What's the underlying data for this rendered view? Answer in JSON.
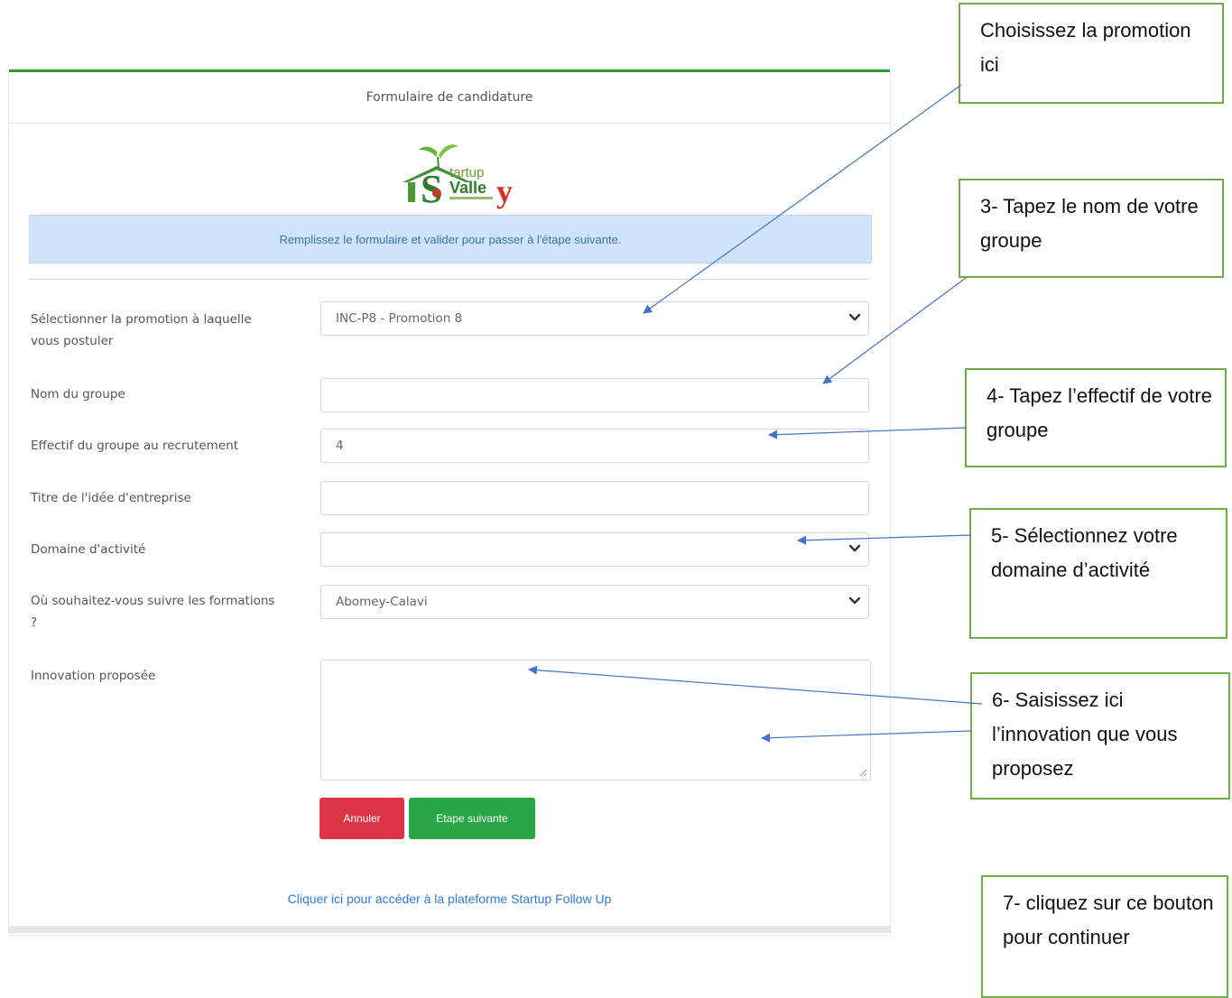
{
  "form": {
    "title": "Formulaire de candidature",
    "banner": "Remplissez le formulaire et valider pour passer à l'étape suivante.",
    "fields": [
      {
        "label": "Sélectionner la promotion à laquelle vous postuler",
        "value": "INC-P8 - Promotion 8",
        "type": "select"
      },
      {
        "label": "Nom du groupe",
        "value": "",
        "type": "text"
      },
      {
        "label": "Effectif du groupe au recrutement",
        "value": "4",
        "type": "number"
      },
      {
        "label": "Titre de l'idée d'entreprise",
        "value": "",
        "type": "text"
      },
      {
        "label": "Domaine d'activité",
        "value": "",
        "type": "select"
      },
      {
        "label": "Où souhaitez-vous suivre les formations ?",
        "value": "Abomey-Calavi",
        "type": "select"
      },
      {
        "label": "Innovation proposée",
        "value": "",
        "type": "textarea"
      }
    ],
    "buttons": {
      "cancel": "Annuler",
      "next": "Etape suivante"
    },
    "footer_link": "Cliquer ici pour accéder à la plateforme Startup Follow Up",
    "colors": {
      "accent": "#2e9b3a",
      "banner_bg": "#cfe4fa",
      "cancel": "#dc3545",
      "next": "#28a745",
      "link": "#2f7ad8"
    }
  },
  "logo": {
    "text_top": "tartup",
    "text_bottom": "Valle",
    "letter_s": "S",
    "letter_y": "y"
  },
  "callouts": [
    {
      "text": "Choisissez la promotion ici"
    },
    {
      "text": "3- Tapez le nom de votre groupe"
    },
    {
      "text": "4- Tapez l’effectif de votre groupe"
    },
    {
      "text": "5- Sélectionnez votre domaine d’activité"
    },
    {
      "text": "6- Saisissez ici l’innovation que vous proposez"
    },
    {
      "text": "7- cliquez sur ce bouton pour continuer"
    }
  ]
}
